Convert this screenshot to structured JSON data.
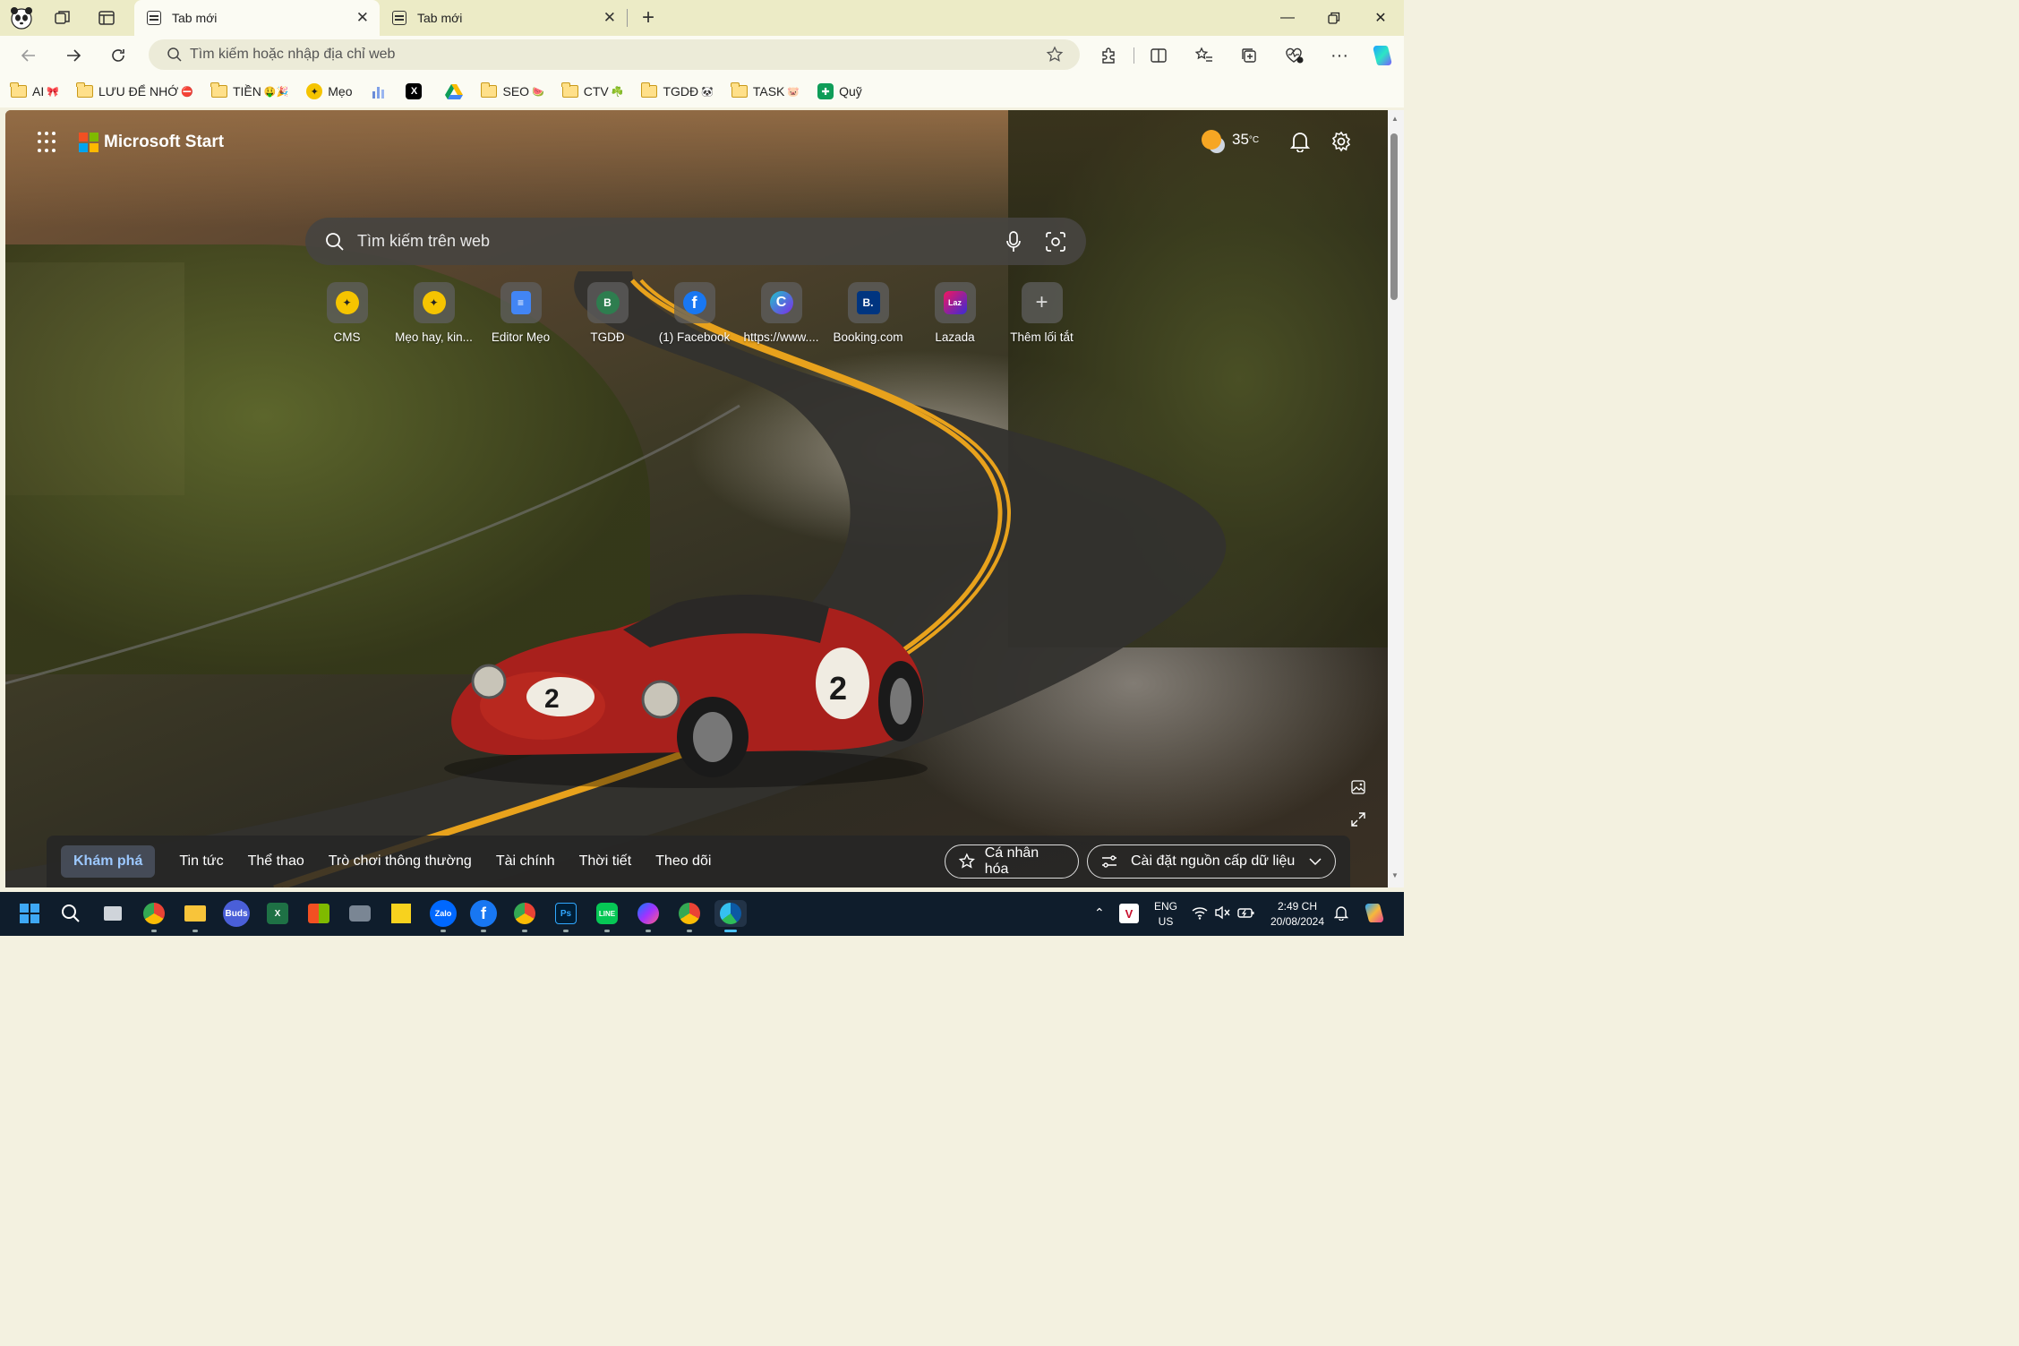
{
  "browser": {
    "tabs": [
      {
        "title": "Tab mới",
        "active": true
      },
      {
        "title": "Tab mới",
        "active": false
      }
    ],
    "address_placeholder": "Tìm kiếm hoặc nhập địa chỉ web"
  },
  "bookmarks": [
    {
      "label": "AI",
      "type": "folder",
      "emoji": "🎀"
    },
    {
      "label": "LƯU ĐỂ NHỚ",
      "type": "folder",
      "emoji": "⛔"
    },
    {
      "label": "TIỀN",
      "type": "folder",
      "emoji": "🤑🎉"
    },
    {
      "label": "Mẹo",
      "type": "site",
      "icon": "meo-icon"
    },
    {
      "label": "",
      "type": "site",
      "icon": "chart-icon"
    },
    {
      "label": "",
      "type": "site",
      "icon": "x-icon"
    },
    {
      "label": "",
      "type": "site",
      "icon": "google-drive-icon"
    },
    {
      "label": "SEO",
      "type": "folder",
      "emoji": "🍉"
    },
    {
      "label": "CTV",
      "type": "folder",
      "emoji": "☘️"
    },
    {
      "label": "TGDĐ",
      "type": "folder",
      "emoji": "🐼"
    },
    {
      "label": "TASK",
      "type": "folder",
      "emoji": "🐷"
    },
    {
      "label": "Quỹ",
      "type": "site",
      "icon": "sheets-icon"
    }
  ],
  "start": {
    "brand": "Microsoft Start",
    "temperature": "35",
    "temp_unit": "°C",
    "search_placeholder": "Tìm kiếm trên web",
    "shortcuts": [
      {
        "label": "CMS",
        "icon": "meo-icon",
        "color": "#f5c400"
      },
      {
        "label": "Mẹo hay, kin...",
        "icon": "meo-icon",
        "color": "#f5c400"
      },
      {
        "label": "Editor Mẹo",
        "icon": "docs-icon",
        "color": "#4285f4"
      },
      {
        "label": "TGDĐ",
        "icon": "tgdd-icon",
        "color": "#2e7d4f",
        "letter": "B"
      },
      {
        "label": "(1) Facebook",
        "icon": "facebook-icon",
        "color": "#1877f2",
        "letter": "f"
      },
      {
        "label": "https://www....",
        "icon": "canva-icon",
        "color": "#20c4cb",
        "letter": "C"
      },
      {
        "label": "Booking.com",
        "icon": "booking-icon",
        "color": "#003580",
        "letter": "B."
      },
      {
        "label": "Lazada",
        "icon": "lazada-icon",
        "color": "#f3165f",
        "letter": "Laz"
      },
      {
        "label": "Thêm lối tắt",
        "icon": "plus-icon",
        "color": "transparent",
        "letter": "+"
      }
    ],
    "feed_tabs": [
      "Khám phá",
      "Tin tức",
      "Thể thao",
      "Trò chơi thông thường",
      "Tài chính",
      "Thời tiết",
      "Theo dõi"
    ],
    "personalize": "Cá nhân hóa",
    "feed_settings": "Cài đặt nguồn cấp dữ liệu"
  },
  "taskbar": {
    "lang_line1": "ENG",
    "lang_line2": "US",
    "time": "2:49 CH",
    "date": "20/08/2024",
    "apps": [
      "start-icon",
      "search-icon",
      "task-view-icon",
      "chrome-icon",
      "file-explorer-icon",
      "buds-icon",
      "excel-icon",
      "store-icon",
      "camera-icon",
      "sticky-notes-icon",
      "zalo-icon",
      "facebook-icon",
      "chrome-profile-icon",
      "photoshop-icon",
      "line-icon",
      "messenger-icon",
      "chrome-profile2-icon",
      "edge-icon"
    ]
  }
}
